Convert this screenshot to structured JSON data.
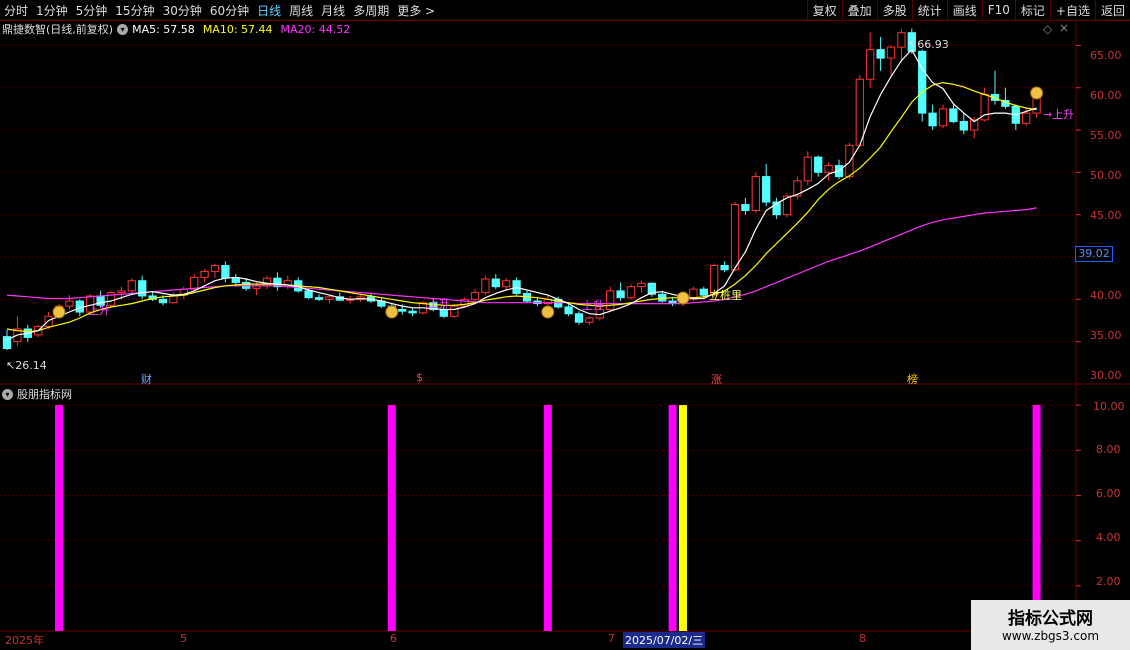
{
  "toolbar": {
    "periods": [
      "分时",
      "1分钟",
      "5分钟",
      "15分钟",
      "30分钟",
      "60分钟",
      "日线",
      "周线",
      "月线",
      "多周期",
      "更多 >"
    ],
    "active_period": "日线",
    "actions": [
      "复权",
      "叠加",
      "多股",
      "统计",
      "画线",
      "F10",
      "标记",
      "+自选",
      "返回"
    ]
  },
  "chart_header": {
    "title": "鼎捷数智(日线,前复权)",
    "ma5_label": "MA5: 57.58",
    "ma10_label": "MA10: 57.44",
    "ma20_label": "MA20: 44.52"
  },
  "indicator_header": {
    "title": "股朋指标网"
  },
  "price_axis": [
    "65.00",
    "60.00",
    "55.00",
    "50.00",
    "45.00",
    "40.00",
    "35.00",
    "30.00"
  ],
  "current_price_tag": "39.02",
  "indicator_axis": [
    "10.00",
    "8.00",
    "6.00",
    "4.00",
    "2.00"
  ],
  "annotations": {
    "high": "66.93",
    "low": "26.14",
    "event_cai": "财",
    "event_dollar": "$",
    "event_zhang": "涨",
    "event_bang": "榜",
    "signal_up": "上升",
    "signal_zt": "立桩里"
  },
  "date_axis": {
    "labels": [
      "2025年",
      "5",
      "6",
      "7",
      "8"
    ],
    "selected": "2025/07/02/三"
  },
  "watermark": {
    "line1": "指标公式网",
    "line2": "www.zbgs3.com"
  },
  "colors": {
    "up": "#ff3232",
    "down": "#54ffff",
    "ma5": "#ffffff",
    "ma10": "#ffff00",
    "ma20": "#ff33ff",
    "grid": "#6a0000"
  },
  "chart_data": {
    "type": "candlestick",
    "title": "鼎捷数智(日线,前复权)",
    "ylim": [
      25,
      68
    ],
    "high_marked": 66.93,
    "low_marked": 26.14,
    "ohlc": [
      [
        30.6,
        31.4,
        29.0,
        29.2
      ],
      [
        30.0,
        33.0,
        29.5,
        31.5
      ],
      [
        31.5,
        32.0,
        30.0,
        30.5
      ],
      [
        30.8,
        32.0,
        30.5,
        31.8
      ],
      [
        31.8,
        33.5,
        31.5,
        33.0
      ],
      [
        33.0,
        34.5,
        32.8,
        34.2
      ],
      [
        34.2,
        35.5,
        33.8,
        34.8
      ],
      [
        34.8,
        35.0,
        33.0,
        33.5
      ],
      [
        33.5,
        35.6,
        33.2,
        35.4
      ],
      [
        35.4,
        36.0,
        34.0,
        34.3
      ],
      [
        34.3,
        36.0,
        34.0,
        35.8
      ],
      [
        35.8,
        36.5,
        35.0,
        36.0
      ],
      [
        36.0,
        37.5,
        35.5,
        37.2
      ],
      [
        37.2,
        37.8,
        35.0,
        35.4
      ],
      [
        35.4,
        36.0,
        34.8,
        35.0
      ],
      [
        35.0,
        35.5,
        34.3,
        34.6
      ],
      [
        34.6,
        35.8,
        34.5,
        35.5
      ],
      [
        35.5,
        36.5,
        35.0,
        36.2
      ],
      [
        36.2,
        38.0,
        35.8,
        37.6
      ],
      [
        37.6,
        38.6,
        37.0,
        38.3
      ],
      [
        38.3,
        39.2,
        37.5,
        39.0
      ],
      [
        39.0,
        39.5,
        37.0,
        37.5
      ],
      [
        37.5,
        38.0,
        36.5,
        37.0
      ],
      [
        37.0,
        37.5,
        36.0,
        36.3
      ],
      [
        36.3,
        37.0,
        35.5,
        36.6
      ],
      [
        36.6,
        37.8,
        36.2,
        37.5
      ],
      [
        37.5,
        38.2,
        36.0,
        36.5
      ],
      [
        36.5,
        37.8,
        36.2,
        37.2
      ],
      [
        37.2,
        37.6,
        35.8,
        36.0
      ],
      [
        36.0,
        36.3,
        35.0,
        35.2
      ],
      [
        35.2,
        35.6,
        34.8,
        35.0
      ],
      [
        35.0,
        35.5,
        34.5,
        35.3
      ],
      [
        35.3,
        35.8,
        34.8,
        34.9
      ],
      [
        34.9,
        35.4,
        34.5,
        35.0
      ],
      [
        35.0,
        35.6,
        34.7,
        35.3
      ],
      [
        35.3,
        35.8,
        34.6,
        34.8
      ],
      [
        34.8,
        35.2,
        34.0,
        34.2
      ],
      [
        34.2,
        34.6,
        33.5,
        33.8
      ],
      [
        33.8,
        34.4,
        33.2,
        33.6
      ],
      [
        33.6,
        34.0,
        33.0,
        33.4
      ],
      [
        33.4,
        34.8,
        33.2,
        34.6
      ],
      [
        34.6,
        35.0,
        33.6,
        33.8
      ],
      [
        33.8,
        34.2,
        32.8,
        33.0
      ],
      [
        33.0,
        34.5,
        32.8,
        34.2
      ],
      [
        34.2,
        35.2,
        34.0,
        35.0
      ],
      [
        35.0,
        36.2,
        34.8,
        35.8
      ],
      [
        35.8,
        37.8,
        35.5,
        37.4
      ],
      [
        37.4,
        38.0,
        36.2,
        36.5
      ],
      [
        36.5,
        37.5,
        36.0,
        37.2
      ],
      [
        37.2,
        37.6,
        35.5,
        35.7
      ],
      [
        35.7,
        36.0,
        34.6,
        34.8
      ],
      [
        34.8,
        35.2,
        34.2,
        34.5
      ],
      [
        34.5,
        35.4,
        34.3,
        35.0
      ],
      [
        35.0,
        35.3,
        33.9,
        34.1
      ],
      [
        34.1,
        34.4,
        33.0,
        33.3
      ],
      [
        33.3,
        33.6,
        32.0,
        32.3
      ],
      [
        32.3,
        33.0,
        32.0,
        32.8
      ],
      [
        32.8,
        34.0,
        32.5,
        33.8
      ],
      [
        33.8,
        36.5,
        33.5,
        36.0
      ],
      [
        36.0,
        37.0,
        34.8,
        35.2
      ],
      [
        35.2,
        36.8,
        35.0,
        36.5
      ],
      [
        36.5,
        37.2,
        35.8,
        36.9
      ],
      [
        36.9,
        37.0,
        35.3,
        35.6
      ],
      [
        35.6,
        36.0,
        34.6,
        34.8
      ],
      [
        34.8,
        35.3,
        34.2,
        34.5
      ],
      [
        34.5,
        35.2,
        34.2,
        35.0
      ],
      [
        35.0,
        36.5,
        34.8,
        36.2
      ],
      [
        36.2,
        36.5,
        35.0,
        35.5
      ],
      [
        35.5,
        39.2,
        35.3,
        39.0
      ],
      [
        39.0,
        39.5,
        38.2,
        38.5
      ],
      [
        38.5,
        46.5,
        38.3,
        46.2
      ],
      [
        46.2,
        47.0,
        45.0,
        45.5
      ],
      [
        45.5,
        50.0,
        45.2,
        49.5
      ],
      [
        49.5,
        51.0,
        46.0,
        46.5
      ],
      [
        46.5,
        47.0,
        44.5,
        45.0
      ],
      [
        45.0,
        47.5,
        44.7,
        47.2
      ],
      [
        47.2,
        49.5,
        46.8,
        49.0
      ],
      [
        49.0,
        52.5,
        48.5,
        51.8
      ],
      [
        51.8,
        52.0,
        49.5,
        50.0
      ],
      [
        50.0,
        51.2,
        49.0,
        50.8
      ],
      [
        50.8,
        51.5,
        49.2,
        49.5
      ],
      [
        49.5,
        53.5,
        49.2,
        53.2
      ],
      [
        53.2,
        61.5,
        53.0,
        61.0
      ],
      [
        61.0,
        66.5,
        60.0,
        64.5
      ],
      [
        64.5,
        66.0,
        62.0,
        63.5
      ],
      [
        63.5,
        65.0,
        61.5,
        64.8
      ],
      [
        64.8,
        66.93,
        63.0,
        66.5
      ],
      [
        66.5,
        67.0,
        64.0,
        64.3
      ],
      [
        64.3,
        64.5,
        56.0,
        57.0
      ],
      [
        57.0,
        58.0,
        55.0,
        55.5
      ],
      [
        55.5,
        58.0,
        55.2,
        57.5
      ],
      [
        57.5,
        58.0,
        55.8,
        56.0
      ],
      [
        56.0,
        57.0,
        54.5,
        55.0
      ],
      [
        55.0,
        56.5,
        54.0,
        56.2
      ],
      [
        56.2,
        60.0,
        56.0,
        59.2
      ],
      [
        59.2,
        62.0,
        58.0,
        58.5
      ],
      [
        58.5,
        60.0,
        57.5,
        57.8
      ],
      [
        57.8,
        58.0,
        55.0,
        55.8
      ],
      [
        55.8,
        57.5,
        55.5,
        57.0
      ],
      [
        57.0,
        59.5,
        56.5,
        59.0
      ]
    ],
    "ma5": [
      30.2,
      30.8,
      31.0,
      31.3,
      32.5,
      33.0,
      33.5,
      34.0,
      34.3,
      34.6,
      34.8,
      35.2,
      35.6,
      35.8,
      35.9,
      35.7,
      35.5,
      35.6,
      36.0,
      36.6,
      37.2,
      37.5,
      37.6,
      37.4,
      37.1,
      36.9,
      36.8,
      36.7,
      36.5,
      36.1,
      35.8,
      35.5,
      35.2,
      35.0,
      35.1,
      35.0,
      34.8,
      34.5,
      34.2,
      34.0,
      34.0,
      33.9,
      33.8,
      33.8,
      34.1,
      34.5,
      35.2,
      35.7,
      36.1,
      36.4,
      36.1,
      35.8,
      35.5,
      35.0,
      34.5,
      33.8,
      33.3,
      33.2,
      33.6,
      34.0,
      34.5,
      35.2,
      35.8,
      35.9,
      35.6,
      35.3,
      35.1,
      35.1,
      35.7,
      36.6,
      38.7,
      40.6,
      43.3,
      45.5,
      46.3,
      47.0,
      47.4,
      48.0,
      48.7,
      49.8,
      50.2,
      51.2,
      53.2,
      56.6,
      59.2,
      61.3,
      63.2,
      64.5,
      62.2,
      60.6,
      59.9,
      58.1,
      57.0,
      56.0,
      56.8,
      57.0,
      57.0,
      56.8,
      57.2,
      57.6
    ],
    "ma10": [
      31.5,
      31.3,
      31.2,
      31.3,
      31.7,
      32.0,
      32.3,
      32.8,
      33.4,
      33.8,
      34.1,
      34.3,
      34.5,
      34.8,
      35.1,
      35.3,
      35.4,
      35.5,
      35.8,
      36.1,
      36.4,
      36.6,
      36.7,
      36.8,
      36.8,
      36.8,
      36.8,
      36.7,
      36.6,
      36.5,
      36.4,
      36.2,
      36.0,
      35.8,
      35.6,
      35.4,
      35.2,
      35.0,
      34.8,
      34.6,
      34.5,
      34.4,
      34.3,
      34.3,
      34.4,
      34.6,
      34.9,
      35.1,
      35.3,
      35.4,
      35.3,
      35.2,
      35.0,
      34.8,
      34.6,
      34.4,
      34.3,
      34.2,
      34.3,
      34.4,
      34.6,
      34.8,
      35.0,
      35.1,
      35.2,
      35.2,
      35.2,
      35.3,
      35.6,
      36.0,
      36.8,
      37.8,
      39.0,
      40.4,
      41.6,
      42.8,
      44.0,
      45.3,
      46.8,
      48.0,
      48.9,
      49.6,
      50.5,
      51.7,
      53.0,
      54.8,
      56.5,
      58.3,
      59.5,
      60.3,
      60.6,
      60.4,
      60.1,
      59.6,
      59.2,
      58.8,
      58.3,
      57.9,
      57.6,
      57.4
    ],
    "ma20": [
      35.5,
      35.4,
      35.3,
      35.2,
      35.1,
      35.1,
      35.1,
      35.2,
      35.3,
      35.4,
      35.5,
      35.6,
      35.7,
      35.8,
      35.9,
      36.0,
      36.1,
      36.2,
      36.3,
      36.4,
      36.5,
      36.6,
      36.6,
      36.6,
      36.6,
      36.6,
      36.6,
      36.5,
      36.4,
      36.3,
      36.2,
      36.1,
      36.0,
      35.9,
      35.8,
      35.7,
      35.6,
      35.5,
      35.4,
      35.3,
      35.2,
      35.1,
      35.0,
      34.9,
      34.8,
      34.7,
      34.6,
      34.6,
      34.6,
      34.6,
      34.6,
      34.6,
      34.6,
      34.6,
      34.6,
      34.5,
      34.5,
      34.5,
      34.5,
      34.5,
      34.5,
      34.5,
      34.5,
      34.5,
      34.5,
      34.5,
      34.6,
      34.7,
      34.8,
      35.0,
      35.3,
      35.6,
      36.0,
      36.5,
      37.0,
      37.5,
      38.0,
      38.5,
      39.0,
      39.5,
      39.9,
      40.3,
      40.7,
      41.2,
      41.7,
      42.2,
      42.7,
      43.2,
      43.7,
      44.1,
      44.4,
      44.6,
      44.8,
      45.0,
      45.2,
      45.3,
      45.4,
      45.5,
      45.6,
      45.8
    ],
    "indicator": {
      "ylim": [
        0,
        10.8
      ],
      "bars": [
        {
          "index": 5,
          "value": 10,
          "color": "#ff00ff"
        },
        {
          "index": 37,
          "value": 10,
          "color": "#ff00ff"
        },
        {
          "index": 52,
          "value": 10,
          "color": "#ff00ff"
        },
        {
          "index": 64,
          "value": 10,
          "color": "#ff00ff"
        },
        {
          "index": 65,
          "value": 10,
          "color": "#ffff00"
        },
        {
          "index": 99,
          "value": 10,
          "color": "#ff00ff"
        }
      ]
    }
  }
}
